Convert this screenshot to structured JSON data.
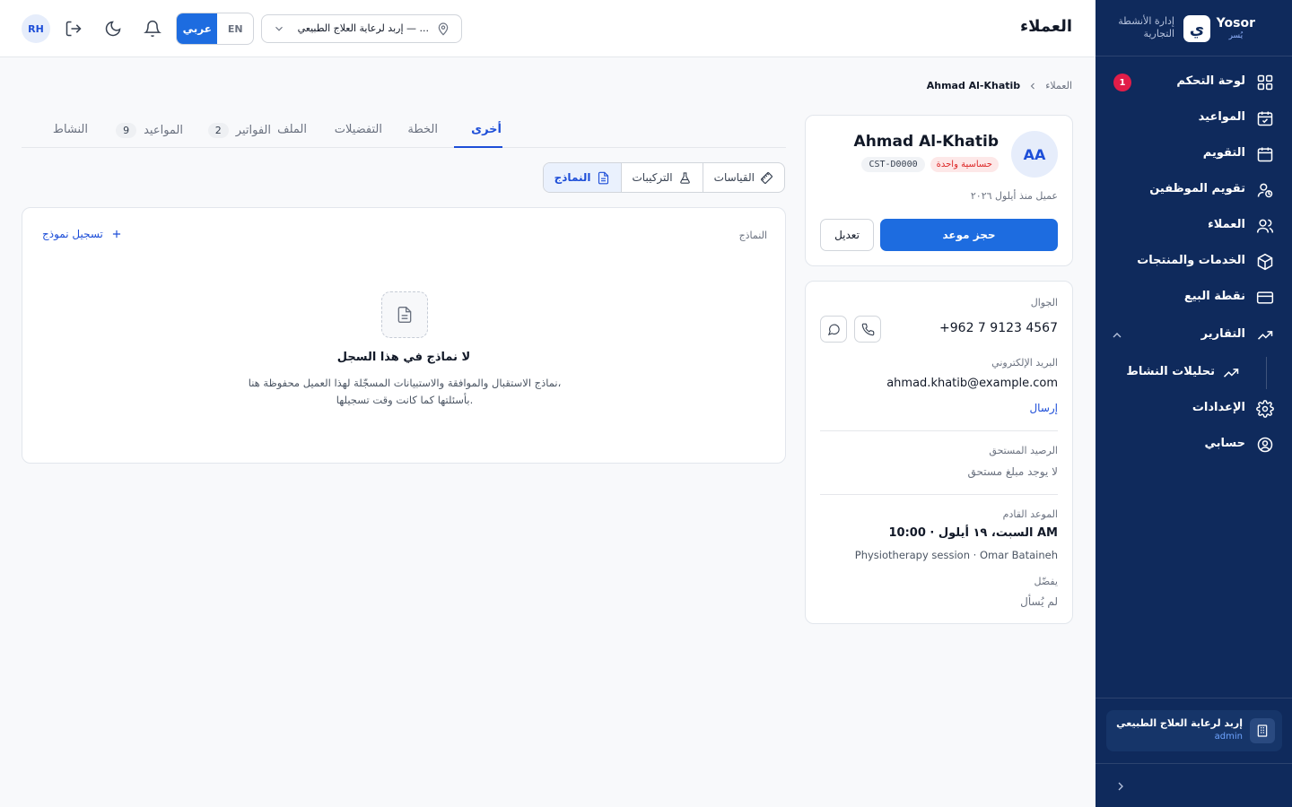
{
  "app": {
    "brand_name": "Yosor",
    "brand_sub": "يُسر",
    "brand_tagline": "إدارة الأنشطة التجارية",
    "logo_glyph": "ي"
  },
  "sidebar": {
    "items": [
      {
        "label": "لوحة التحكم",
        "icon": "dashboard-icon",
        "badge": "1"
      },
      {
        "label": "المواعيد",
        "icon": "calendar-check-icon"
      },
      {
        "label": "التقويم",
        "icon": "calendar-icon"
      },
      {
        "label": "تقويم الموظفين",
        "icon": "staff-calendar-icon"
      },
      {
        "label": "العملاء",
        "icon": "users-icon"
      },
      {
        "label": "الخدمات والمنتجات",
        "icon": "box-icon"
      },
      {
        "label": "نقطة البيع",
        "icon": "credit-card-icon"
      },
      {
        "label": "التقارير",
        "icon": "trending-up-icon"
      },
      {
        "label": "تحليلات النشاط",
        "icon": "trending-up-icon"
      },
      {
        "label": "الإعدادات",
        "icon": "gear-icon"
      },
      {
        "label": "حسابي",
        "icon": "user-circle-icon"
      }
    ],
    "org": {
      "name": "إربد لرعاية العلاج الطبيعي",
      "role": "admin"
    }
  },
  "topbar": {
    "title": "العملاء",
    "user_initials": "RH",
    "lang_en": "EN",
    "lang_ar": "عربي",
    "location": "إربد لرعاية العلاج الطبيعي — ..."
  },
  "breadcrumb": {
    "root": "العملاء",
    "current": "Ahmad Al-Khatib"
  },
  "customer": {
    "initials": "AA",
    "name": "Ahmad Al-Khatib",
    "allergy_tag": "حساسية واحدة",
    "id": "CST-D0000",
    "since": "عميل منذ أيلول ٢٠٢٦",
    "book_label": "حجز موعد",
    "edit_label": "تعديل"
  },
  "info": {
    "mobile_label": "الجوال",
    "mobile": "+962 7 9123 4567",
    "email_label": "البريد الإلكتروني",
    "email": "ahmad.khatib@example.com",
    "send_label": "إرسال",
    "balance_label": "الرصيد المستحق",
    "balance": "لا يوجد مبلغ مستحق",
    "next_label": "الموعد القادم",
    "next_date": "السبت، ١٩ أيلول · 10:00 AM",
    "next_detail": "Physiotherapy session · Omar Bataineh",
    "pref_label": "يفضّل",
    "pref_value": "لم يُسأل"
  },
  "tabs": [
    {
      "label": "أخرى",
      "active": true
    },
    {
      "label": "الخطة"
    },
    {
      "label": "التفضيلات"
    },
    {
      "label": "الملف"
    },
    {
      "label": "الفواتير",
      "count": "2"
    },
    {
      "label": "المواعيد",
      "count": "9"
    },
    {
      "label": "النشاط"
    }
  ],
  "subtabs": [
    {
      "label": "القياسات",
      "icon": "ruler-icon"
    },
    {
      "label": "التركيبات",
      "icon": "flask-icon"
    },
    {
      "label": "النماذج",
      "icon": "document-icon",
      "active": true
    }
  ],
  "forms": {
    "title": "النماذج",
    "add_label": "تسجيل نموذج",
    "empty_title": "لا نماذج في هذا السجل",
    "empty_desc_1": "نماذج الاستقبال والموافقة والاستبيانات المسجّلة لهذا العميل محفوظة هنا،",
    "empty_desc_2": "بأسئلتها كما كانت وقت تسجيلها."
  },
  "colors": {
    "sidebar": "#0f2a5c",
    "primary": "#1d6ce0",
    "badge": "#e11d48"
  }
}
